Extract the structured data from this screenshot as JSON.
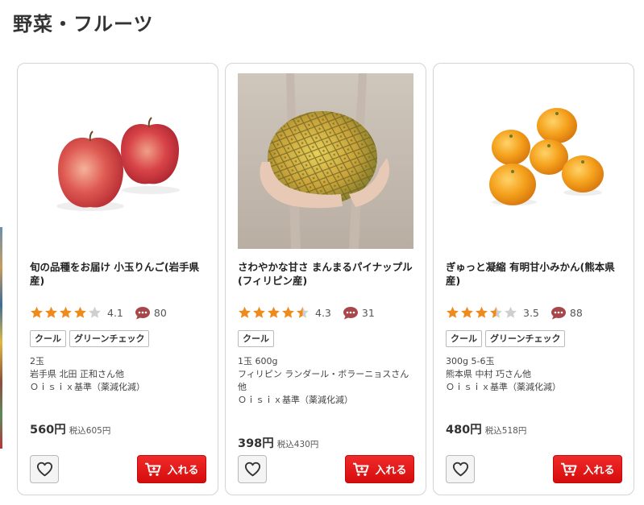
{
  "section": {
    "title": "野菜・フルーツ"
  },
  "colors": {
    "star_filled": "#ef8a1c",
    "star_empty": "#cfcfcf",
    "comment": "#a8474a",
    "cart_button": "#e01818"
  },
  "products": [
    {
      "name": "旬の品種をお届け 小玉りんご(岩手県産)",
      "rating": "4.1",
      "rating_value": 4.1,
      "review_count": "80",
      "tags": [
        "クール",
        "グリーンチェック"
      ],
      "details": [
        "2玉",
        "岩手県 北田 正和さん他",
        "Ｏｉｓｉｘ基準（薬減化減）"
      ],
      "price": "560円",
      "price_tax": "税込605円",
      "cart_label": "入れる",
      "image_icon": "apple-photo"
    },
    {
      "name": "さわやかな甘さ まんまるパイナップル(フィリピン産)",
      "rating": "4.3",
      "rating_value": 4.3,
      "review_count": "31",
      "tags": [
        "クール"
      ],
      "details": [
        "1玉 600g",
        "フィリピン ランダール・ボラーニョスさん他",
        "Ｏｉｓｉｘ基準（薬減化減）"
      ],
      "price": "398円",
      "price_tax": "税込430円",
      "cart_label": "入れる",
      "image_icon": "pineapple-photo"
    },
    {
      "name": "ぎゅっと凝縮 有明甘小みかん(熊本県産)",
      "rating": "3.5",
      "rating_value": 3.5,
      "review_count": "88",
      "tags": [
        "クール",
        "グリーンチェック"
      ],
      "details": [
        "300g 5-6玉",
        "熊本県 中村 巧さん他",
        "Ｏｉｓｉｘ基準（薬減化減）"
      ],
      "price": "480円",
      "price_tax": "税込518円",
      "cart_label": "入れる",
      "image_icon": "mandarin-photo"
    }
  ]
}
